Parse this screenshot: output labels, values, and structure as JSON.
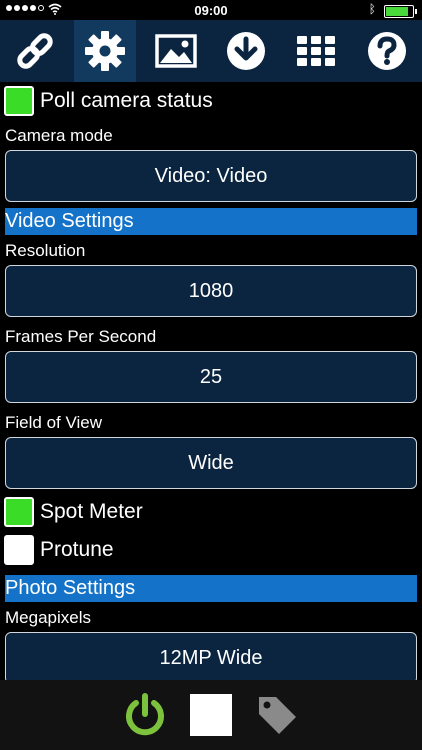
{
  "status": {
    "time": "09:00",
    "wifi": "wifi-icon",
    "bluetooth": "bluetooth-icon",
    "battery_level": 0.85
  },
  "toolbar": {
    "items": [
      {
        "name": "link-icon"
      },
      {
        "name": "settings-gear-icon",
        "active": true
      },
      {
        "name": "gallery-image-icon"
      },
      {
        "name": "download-icon"
      },
      {
        "name": "grid-apps-icon"
      },
      {
        "name": "help-icon"
      }
    ]
  },
  "settings": {
    "poll_camera_status": {
      "label": "Poll camera status",
      "checked": true
    },
    "camera_mode": {
      "label": "Camera mode",
      "value": "Video: Video"
    },
    "video_section": "Video Settings",
    "resolution": {
      "label": "Resolution",
      "value": "1080"
    },
    "fps": {
      "label": "Frames Per Second",
      "value": "25"
    },
    "fov": {
      "label": "Field of View",
      "value": "Wide"
    },
    "spot_meter": {
      "label": "Spot Meter",
      "checked": true
    },
    "protune": {
      "label": "Protune",
      "checked": false
    },
    "photo_section": "Photo Settings",
    "megapixels": {
      "label": "Megapixels",
      "value": "12MP Wide"
    }
  },
  "bottom": {
    "power": "power-icon",
    "stop": "stop-icon",
    "tag": "tag-icon"
  },
  "colors": {
    "accent_blue": "#1473c8",
    "field_bg": "#0b2540",
    "check_green": "#3bdc28",
    "power_green": "#7cc23c"
  }
}
